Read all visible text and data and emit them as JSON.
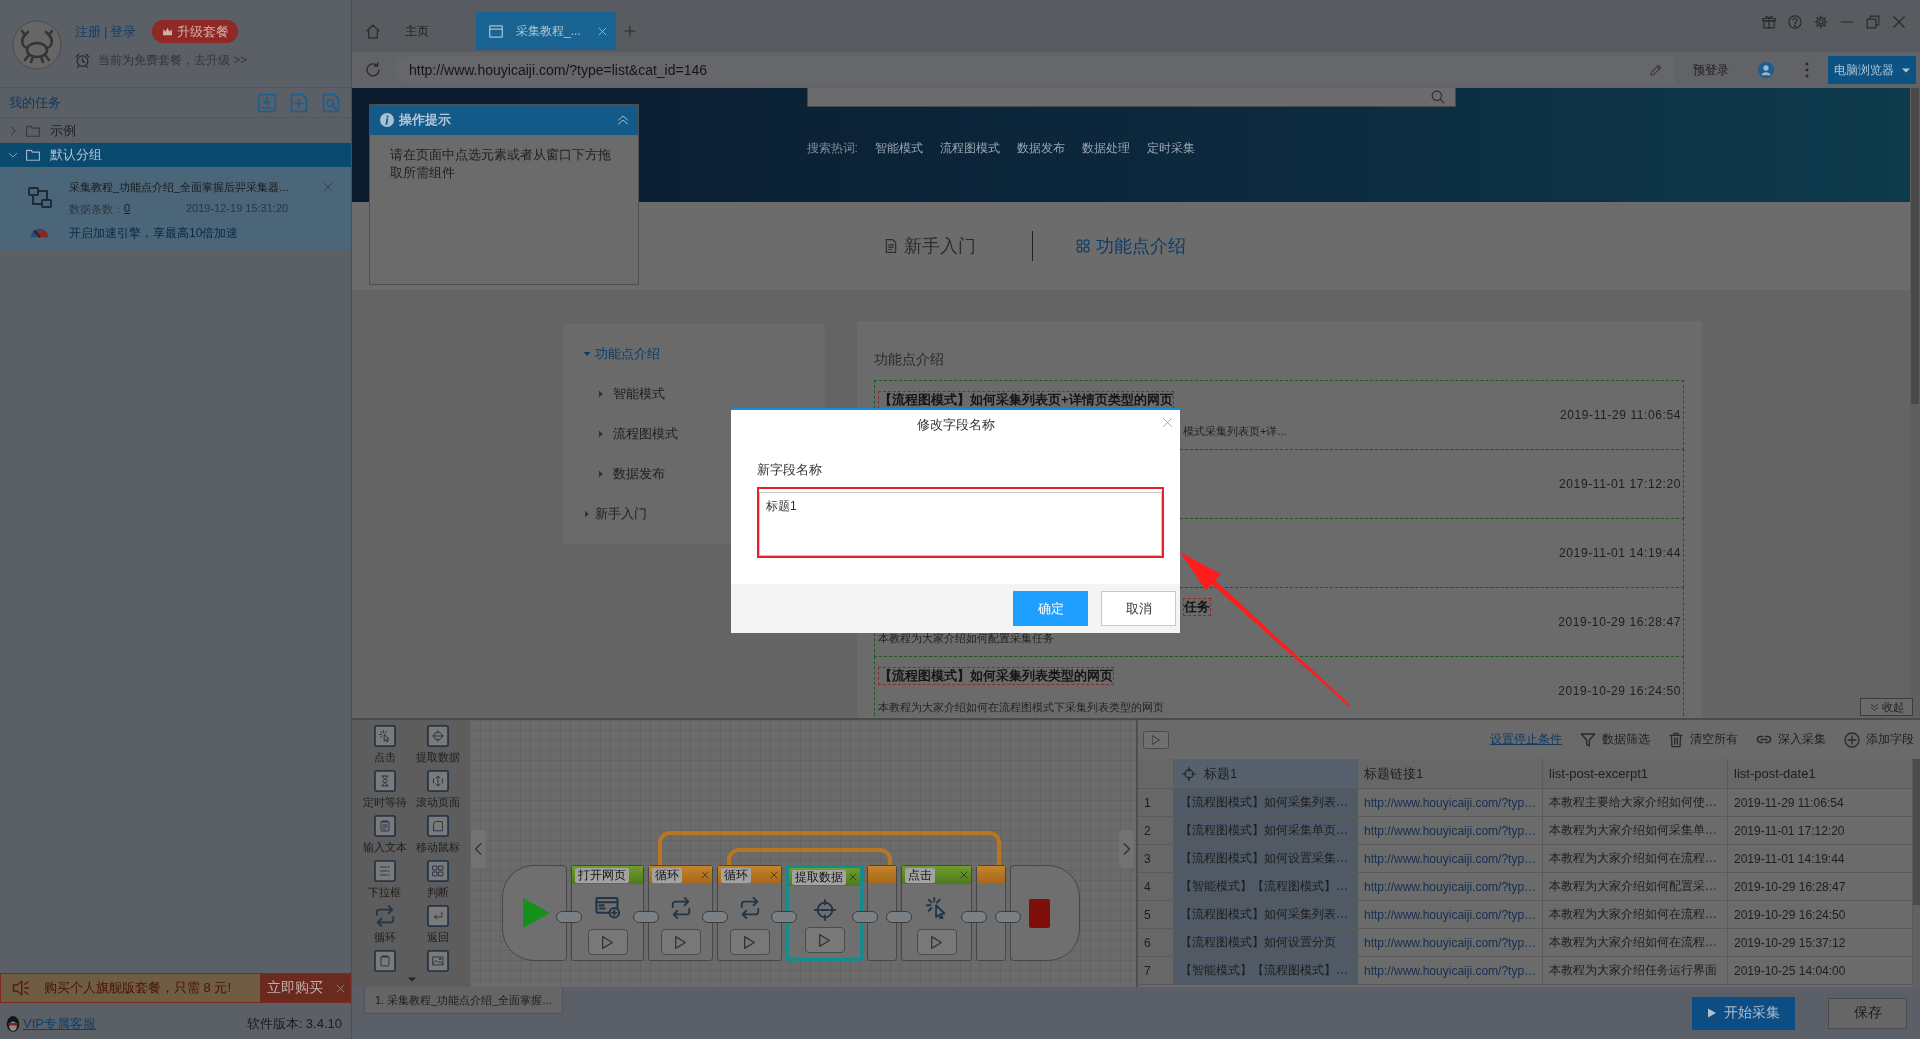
{
  "sidebar": {
    "account": {
      "register": "注册",
      "separator": "|",
      "login": "登录",
      "upgrade": "升级套餐",
      "plan_notice": "当前为免费套餐，去升级 >>"
    },
    "tasks_title": "我的任务",
    "groups": [
      {
        "label": "示例",
        "expanded": false,
        "selected": false
      },
      {
        "label": "默认分组",
        "expanded": true,
        "selected": true,
        "children": [
          {
            "title": "采集教程_功能点介绍_全面掌握后羿采集器...",
            "count_label": "数据条数：",
            "count": "0",
            "date": "2019-12-19 15:31:20",
            "boost": "开启加速引擎，享最高10倍加速"
          }
        ]
      }
    ],
    "promo": {
      "text": "购买个人旗舰版套餐，只需 8 元!",
      "button": "立即购买"
    },
    "footer": {
      "support": "VIP专属客服",
      "version": "软件版本: 3.4.10"
    }
  },
  "browser": {
    "tabs": [
      {
        "kind": "home",
        "label": "主页",
        "selected": false,
        "closable": false
      },
      {
        "kind": "page",
        "label": "采集教程_...",
        "selected": true,
        "closable": true
      }
    ],
    "url": "http://www.houyicaiji.com/?type=list&cat_id=146",
    "pre_login": "预登录",
    "mode": "电脑浏览器"
  },
  "webpage": {
    "hint_panel": {
      "title": "操作提示",
      "text": "请在页面中点选元素或者从窗口下方拖取所需组件"
    },
    "hot_label": "搜索热词:",
    "hot_words": [
      "智能模式",
      "流程图模式",
      "数据发布",
      "数据处理",
      "定时采集"
    ],
    "section_tabs": [
      {
        "label": "新手入门",
        "selected": false
      },
      {
        "label": "功能点介绍",
        "selected": true
      }
    ],
    "menu": [
      {
        "label": "功能点介绍",
        "expanded": true,
        "selected": true,
        "children": [
          {
            "label": "智能模式",
            "expanded": false,
            "selected": false
          },
          {
            "label": "流程图模式",
            "expanded": false,
            "selected": false
          },
          {
            "label": "数据发布",
            "expanded": false,
            "selected": false
          }
        ]
      },
      {
        "label": "新手入门",
        "expanded": false,
        "selected": false
      }
    ],
    "list_title": "功能点介绍",
    "articles": [
      {
        "kind": "excerpt_covered",
        "title": "【流程图模式】如何采集列表页+详情页类型的网页",
        "excerpt": "模式采集列表页+详...",
        "date": "2019-11-29 11:06:54"
      },
      {
        "kind": "date_only",
        "date": "2019-11-01 17:12:20"
      },
      {
        "kind": "date_only",
        "date": "2019-11-01 14:19:44"
      },
      {
        "kind": "title_covered",
        "title": "任务",
        "excerpt": "本教程为大家介绍如何配置采集任务",
        "date": "2019-10-29 16:28:47"
      },
      {
        "kind": "full",
        "title": "【流程图模式】如何采集列表类型的网页",
        "excerpt": "本教程为大家介绍如何在流程图模式下采集列表类型的网页",
        "date": "2019-10-29 16:24:50"
      }
    ],
    "collapse": "收起"
  },
  "dialog": {
    "title": "修改字段名称",
    "field_label": "新字段名称",
    "value": "标题1",
    "confirm": "确定",
    "cancel": "取消"
  },
  "designer": {
    "tools": [
      {
        "kind": "click",
        "label": "点击"
      },
      {
        "kind": "extract",
        "label": "提取数据"
      },
      {
        "kind": "wait",
        "label": "定时等待"
      },
      {
        "kind": "scroll",
        "label": "滚动页面"
      },
      {
        "kind": "input",
        "label": "输入文本"
      },
      {
        "kind": "mouse",
        "label": "移动鼠标"
      },
      {
        "kind": "dropdown",
        "label": "下拉框"
      },
      {
        "kind": "condition",
        "label": "判断"
      },
      {
        "kind": "loop",
        "label": "循环"
      },
      {
        "kind": "back",
        "label": "返回"
      },
      {
        "kind": "page"
      },
      {
        "kind": "image"
      }
    ],
    "flow": [
      {
        "kind": "start"
      },
      {
        "kind": "open_page",
        "label": "打开网页",
        "selected": false,
        "removable": false
      },
      {
        "kind": "loop",
        "label": "循环",
        "selected": false,
        "removable": true,
        "children": [
          {
            "kind": "loop",
            "label": "循环",
            "selected": false,
            "removable": true,
            "children": [
              {
                "kind": "extract",
                "label": "提取数据",
                "selected": true,
                "removable": true
              }
            ]
          },
          {
            "kind": "click",
            "label": "点击",
            "selected": false,
            "removable": true
          }
        ]
      },
      {
        "kind": "end"
      }
    ],
    "task_tab": "1. 采集教程_功能点介绍_全面掌握..."
  },
  "data_panel": {
    "actions": [
      {
        "kind": "link",
        "label": "设置停止条件"
      },
      {
        "kind": "filter",
        "label": "数据筛选"
      },
      {
        "kind": "clear",
        "label": "清空所有"
      },
      {
        "kind": "deep",
        "label": "深入采集"
      },
      {
        "kind": "add",
        "label": "添加字段"
      }
    ],
    "columns": [
      {
        "label": "标题1",
        "kind": "text",
        "selected": true
      },
      {
        "label": "标题链接1",
        "kind": "url",
        "selected": false
      },
      {
        "label": "list-post-excerpt1",
        "kind": "text",
        "selected": false
      },
      {
        "label": "list-post-date1",
        "kind": "text",
        "selected": false
      }
    ],
    "rows": [
      {
        "number": "1",
        "cells": [
          "【流程图模式】如何采集列表…",
          "http://www.houyicaiji.com/?typ…",
          "本教程主要给大家介绍如何使…",
          "2019-11-29 11:06:54"
        ]
      },
      {
        "number": "2",
        "cells": [
          "【流程图模式】如何采集单页…",
          "http://www.houyicaiji.com/?typ…",
          "本教程为大家介绍如何采集单…",
          "2019-11-01 17:12:20"
        ]
      },
      {
        "number": "3",
        "cells": [
          "【流程图模式】如何设置采集…",
          "http://www.houyicaiji.com/?typ…",
          "本教程为大家介绍如何在流程…",
          "2019-11-01 14:19:44"
        ]
      },
      {
        "number": "4",
        "cells": [
          "【智能模式】【流程图模式】…",
          "http://www.houyicaiji.com/?typ…",
          "本教程为大家介绍如何配置采…",
          "2019-10-29 16:28:47"
        ]
      },
      {
        "number": "5",
        "cells": [
          "【流程图模式】如何采集列表…",
          "http://www.houyicaiji.com/?typ…",
          "本教程为大家介绍如何在流程…",
          "2019-10-29 16:24:50"
        ]
      },
      {
        "number": "6",
        "cells": [
          "【流程图模式】如何设置分页",
          "http://www.houyicaiji.com/?typ…",
          "本教程为大家介绍如何在流程…",
          "2019-10-29 15:37:12"
        ]
      },
      {
        "number": "7",
        "cells": [
          "【智能模式】【流程图模式】…",
          "http://www.houyicaiji.com/?typ…",
          "本教程为大家介绍任务运行界面",
          "2019-10-25 14:04:00"
        ]
      }
    ],
    "start": "开始采集",
    "save": "保存"
  }
}
